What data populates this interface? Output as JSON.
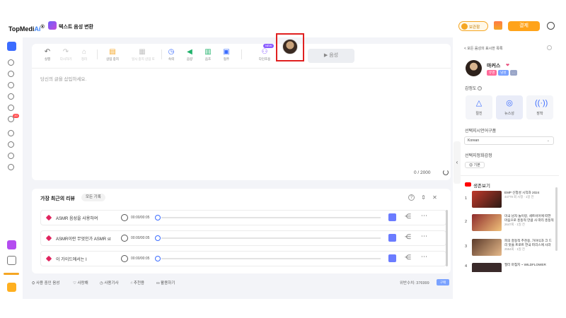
{
  "header": {
    "logo_main": "TopMedi",
    "logo_ai": "Ai",
    "logo_reg": "®",
    "app_title": "텍스트 음성 변환",
    "coin_label": "보관함",
    "pay_label": "결제",
    "colors": {
      "accent": "#3b6cff",
      "pay": "#ffa31a",
      "coin": "#f5a623"
    }
  },
  "rail": {
    "icons": [
      "home-icon",
      "tts-icon",
      "clone-icon",
      "mic-icon",
      "brush-icon",
      "inbox-icon",
      "globe-icon",
      "target-icon",
      "music-icon",
      "spark-icon"
    ],
    "badge": "20"
  },
  "toolbar": {
    "items": [
      {
        "label": "실행",
        "icon": "undo-icon",
        "disabled": false
      },
      {
        "label": "다시하기",
        "icon": "redo-icon",
        "disabled": true
      },
      {
        "label": "정리",
        "icon": "clean-icon",
        "disabled": true
      },
      {
        "label": "삽입 중지",
        "icon": "pause-insert-icon",
        "disabled": false
      },
      {
        "label": "일시 중지 삽입 또",
        "icon": "multi-pause-icon",
        "disabled": true
      },
      {
        "label": "속력",
        "icon": "speed-icon",
        "disabled": false
      },
      {
        "label": "음량",
        "icon": "volume-icon",
        "disabled": false
      },
      {
        "label": "음조",
        "icon": "pitch-icon",
        "disabled": false
      },
      {
        "label": "협주",
        "icon": "accompany-icon",
        "disabled": false
      },
      {
        "label": "다인조용",
        "icon": "multi-speaker-icon",
        "disabled": false
      }
    ],
    "new_tag": "NEW",
    "play_label": "▶ 음성"
  },
  "editor": {
    "placeholder": "당신의 글을 삽입하세요.",
    "counter": "0 / 2000"
  },
  "history": {
    "title": "가장 최근의 리뷰",
    "tab": "모든 기록",
    "rows": [
      {
        "text": "ASMR 음성을 사용하여",
        "time": "00:00/00:05"
      },
      {
        "text": "ASMR이란 무엇인가 ASMR st",
        "time": "00:00/00:05"
      },
      {
        "text": "이 가이드에서는 I",
        "time": "00:00/00:05"
      }
    ]
  },
  "footer": {
    "items": [
      "사용 중인 음성",
      "사랑해",
      "사용기사",
      "추천용",
      "활용하기"
    ],
    "credits": "위반수치: 376999",
    "badge": "구매"
  },
  "right_panel": {
    "back_label": "< 모든 음성의 표시한 목록",
    "voice_name": "마커스",
    "tags": [
      {
        "label": "유명",
        "color": "#ff6b9a"
      },
      {
        "label": "남성",
        "color": "#7aa2ff"
      },
      {
        "label": "…",
        "color": "#9aa6c8"
      }
    ],
    "style_label": "감정도",
    "styles": [
      {
        "label": "절친",
        "icon": "triangle-icon"
      },
      {
        "label": "뉴스성",
        "icon": "broadcast-icon"
      },
      {
        "label": "장착",
        "icon": "signal-icon"
      }
    ],
    "lang_label": "선택지시언어구품",
    "lang_value": "Korean",
    "emotion_label": "선택지정화감정",
    "emotion_chip": "😊 기본",
    "videos_title": "생존보기",
    "videos": [
      {
        "num": "1",
        "title": "EMP 신청성 시작과 2024",
        "meta": "44779 회 시청 · 1일 전",
        "thumb": "#c0392b"
      },
      {
        "num": "2",
        "title": "미국 남자 놀이랑, 세트비어에 따한 마음으로 흥동적 만큼 사 따리 흥동적",
        "meta": "2647회 · 1일 전",
        "thumb": "#8e2b2b"
      },
      {
        "num": "3",
        "title": "피의 흥동적 추천용, 가야식과 크 드리 맛을 트로트 한국 파리스에 사라",
        "meta": "2554회 · 1일 전",
        "thumb": "#5b3a2a"
      },
      {
        "num": "4",
        "title": "필터 마침지 ~ WILDFLOWER",
        "meta": "",
        "thumb": "#3a2a2a"
      }
    ]
  }
}
